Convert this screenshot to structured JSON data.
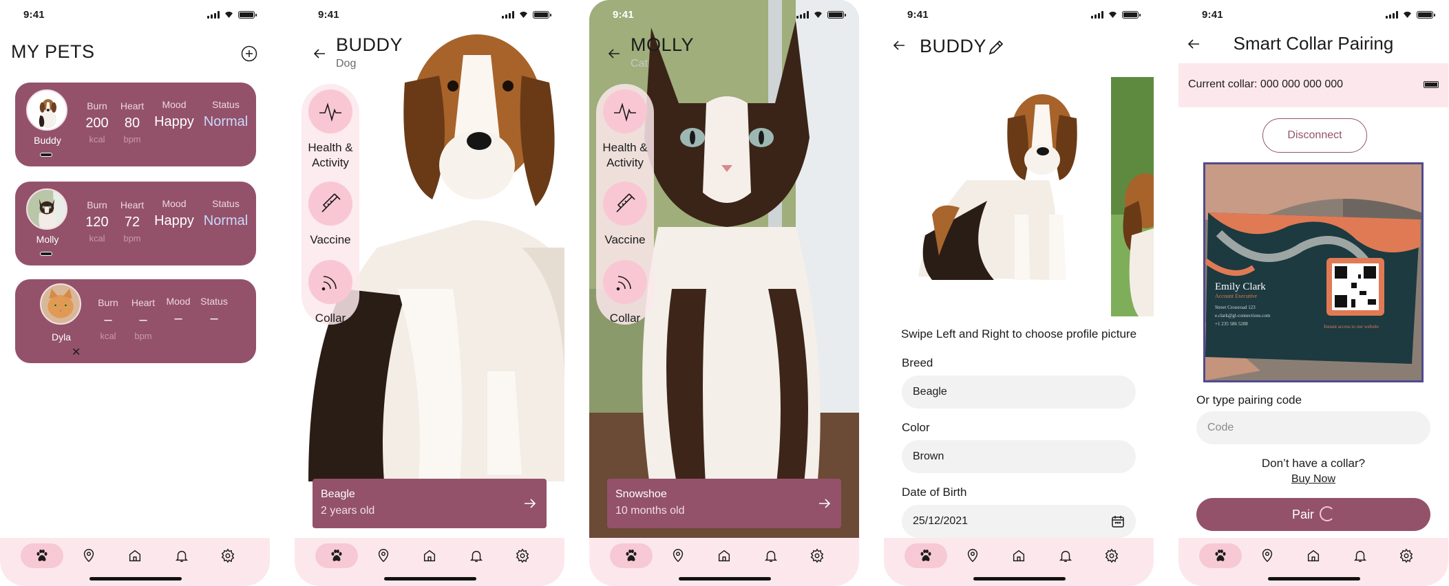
{
  "status": {
    "time": "9:41"
  },
  "nav": [
    "paw",
    "location",
    "home",
    "bell",
    "gear"
  ],
  "screen1": {
    "title": "MY PETS",
    "labels": {
      "burn": "Burn",
      "heart": "Heart",
      "mood": "Mood",
      "status": "Status",
      "kcal": "kcal",
      "bpm": "bpm"
    },
    "pets": [
      {
        "name": "Buddy",
        "burn": "200",
        "heart": "80",
        "mood": "Happy",
        "status": "Normal"
      },
      {
        "name": "Molly",
        "burn": "120",
        "heart": "72",
        "mood": "Happy",
        "status": "Normal"
      },
      {
        "name": "Dyla",
        "burn": "–",
        "heart": "–",
        "mood": "–",
        "status": "–"
      }
    ]
  },
  "screen2": {
    "title": "BUDDY",
    "subtitle": "Dog",
    "menu": [
      "Health &",
      "Activity",
      "Vaccine",
      "Collar"
    ],
    "card_breed": "Beagle",
    "card_age": "2 years old"
  },
  "screen3": {
    "title": "MOLLY",
    "subtitle": "Cat",
    "menu": [
      "Health &",
      "Activity",
      "Vaccine",
      "Collar"
    ],
    "card_breed": "Snowshoe",
    "card_age": "10 months old"
  },
  "screen4": {
    "title": "BUDDY",
    "hint": "Swipe Left  and Right to choose profile picture",
    "breed_label": "Breed",
    "breed_value": "Beagle",
    "color_label": "Color",
    "color_value": "Brown",
    "dob_label": "Date of Birth",
    "dob_value": "25/12/2021"
  },
  "screen5": {
    "title": "Smart Collar Pairing",
    "current": "Current collar: 000 000 000 000",
    "disconnect": "Disconnect",
    "card_name": "Emily Clark",
    "card_role": "Account Executive",
    "card_addr": "Street Crossroad 123",
    "card_email": "e.clark@gl-connections.com",
    "card_phone": "+1 235 586 5208",
    "card_cta": "Instant access to our website",
    "code_label": "Or type pairing code",
    "code_placeholder": "Code",
    "question": "Don’t have a collar?",
    "buy": "Buy Now",
    "pair": "Pair"
  }
}
